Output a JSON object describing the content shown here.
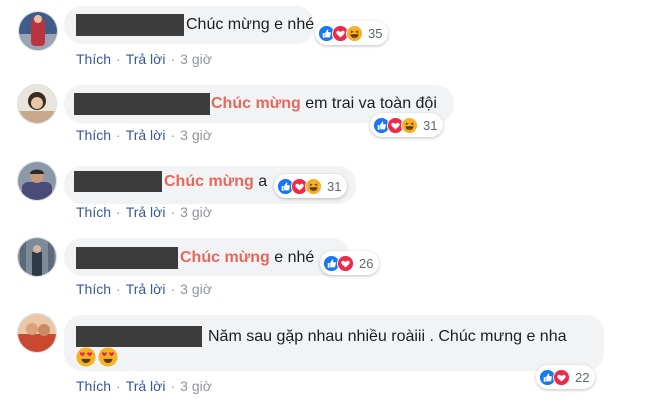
{
  "actions": {
    "like": "Thích",
    "reply": "Trả lời",
    "sep": "·"
  },
  "comments": [
    {
      "pre": "",
      "hl": "",
      "post": "Chúc mừng e nhé",
      "reactions": 35,
      "time": "3 giờ",
      "avatar_color": "#b8353f"
    },
    {
      "pre": "",
      "hl": "Chúc mừng",
      "post": " em trai va toàn đội",
      "reactions": 31,
      "time": "3 giờ",
      "avatar_color": "#c9a98c"
    },
    {
      "pre": "",
      "hl": "Chúc mừng",
      "post": " a",
      "reactions": 31,
      "time": "3 giờ",
      "avatar_color": "#4a4c78"
    },
    {
      "pre": "",
      "hl": "Chúc mừng",
      "post": " e nhé",
      "reactions": 26,
      "time": "3 giờ",
      "avatar_color": "#7d8a9a"
    },
    {
      "pre": "",
      "hl": "",
      "post": "Năm sau gặp nhau nhiều roàiii . Chúc mưng e nha",
      "reactions": 22,
      "time": "3 giờ",
      "avatar_color": "#c8492f",
      "emojis": [
        "heart-eyes-emoji",
        "heart-eyes-emoji"
      ]
    }
  ],
  "icons": {
    "like": "like-icon",
    "love": "love-icon",
    "haha": "haha-icon"
  },
  "colors": {
    "highlight": "#e9675a",
    "link": "#385898",
    "bubble": "#f2f3f5",
    "like": "#1877f2",
    "love": "#f0284a",
    "haha": "#f7b125"
  }
}
